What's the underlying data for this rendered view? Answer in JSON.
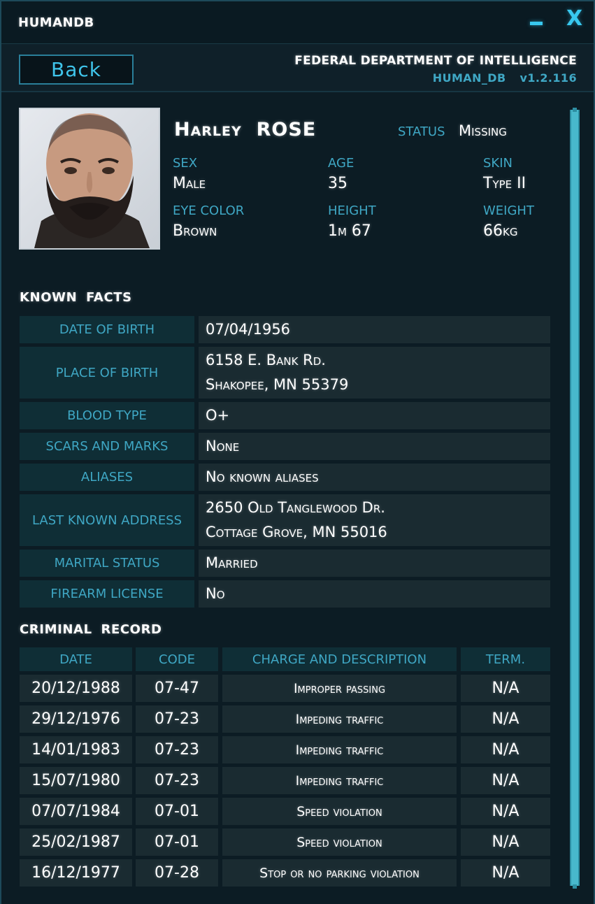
{
  "window": {
    "title": "HUMANDB",
    "minimize_icon": "minimize-icon",
    "close_glyph": "X"
  },
  "header": {
    "back_label": "Back",
    "agency": "FEDERAL DEPARTMENT OF INTELLIGENCE",
    "db_name": "HUMAN_DB",
    "version": "v1.2.116"
  },
  "profile": {
    "first_name": "Harley",
    "last_name": "ROSE",
    "status_label": "STATUS",
    "status_value": "Missing",
    "sex_label": "SEX",
    "sex_value": "Male",
    "age_label": "AGE",
    "age_value": "35",
    "skin_label": "SKIN",
    "skin_value": "Type II",
    "eye_label": "EYE COLOR",
    "eye_value": "Brown",
    "height_label": "HEIGHT",
    "height_value": "1m 67",
    "weight_label": "WEIGHT",
    "weight_value": "66kg"
  },
  "known_facts": {
    "title": "KNOWN FACTS",
    "rows": [
      {
        "label": "DATE OF BIRTH",
        "line1": "07/04/1956",
        "line2": ""
      },
      {
        "label": "PLACE OF BIRTH",
        "line1": "6158 E. Bank Rd.",
        "line2": "Shakopee, MN 55379"
      },
      {
        "label": "BLOOD TYPE",
        "line1": "O+",
        "line2": ""
      },
      {
        "label": "SCARS AND MARKS",
        "line1": "None",
        "line2": ""
      },
      {
        "label": "ALIASES",
        "line1": "No known aliases",
        "line2": ""
      },
      {
        "label": "LAST KNOWN ADDRESS",
        "line1": "2650 Old Tanglewood Dr.",
        "line2": "Cottage Grove, MN 55016"
      },
      {
        "label": "MARITAL STATUS",
        "line1": "Married",
        "line2": ""
      },
      {
        "label": "FIREARM LICENSE",
        "line1": "No",
        "line2": ""
      }
    ]
  },
  "criminal_record": {
    "title": "CRIMINAL RECORD",
    "headers": [
      "DATE",
      "CODE",
      "CHARGE AND DESCRIPTION",
      "TERM."
    ],
    "rows": [
      [
        "20/12/1988",
        "07-47",
        "Improper passing",
        "N/A"
      ],
      [
        "29/12/1976",
        "07-23",
        "Impeding traffic",
        "N/A"
      ],
      [
        "14/01/1983",
        "07-23",
        "Impeding traffic",
        "N/A"
      ],
      [
        "15/07/1980",
        "07-23",
        "Impeding traffic",
        "N/A"
      ],
      [
        "07/07/1984",
        "07-01",
        "Speed violation",
        "N/A"
      ],
      [
        "25/02/1987",
        "07-01",
        "Speed violation",
        "N/A"
      ],
      [
        "16/12/1977",
        "07-28",
        "Stop or no parking violation",
        "N/A"
      ]
    ]
  },
  "colors": {
    "accent": "#3fa7c4",
    "accent_bright": "#38c8ef",
    "background": "#0c1c24",
    "label_cell": "#0f2e36",
    "value_cell": "#1a2b31"
  }
}
